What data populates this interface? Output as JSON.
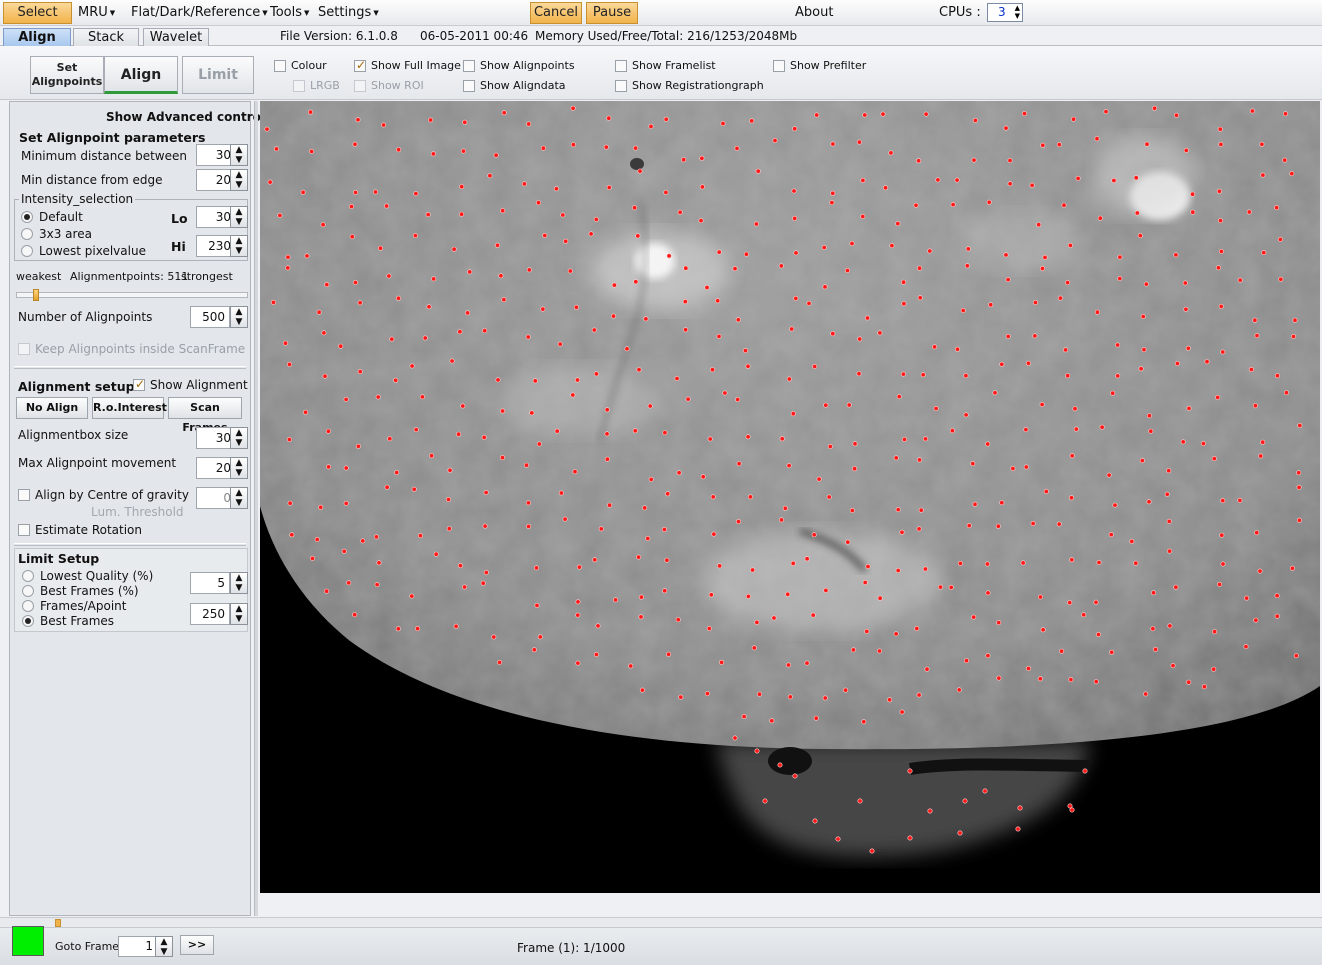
{
  "menu": {
    "select": "Select",
    "mru": "MRU",
    "flat": "Flat/Dark/Reference",
    "tools": "Tools",
    "settings": "Settings",
    "cancel": "Cancel",
    "pause": "Pause",
    "about": "About",
    "cpus_label": "CPUs :",
    "cpus_value": "3"
  },
  "tabs": [
    "Align",
    "Stack",
    "Wavelet"
  ],
  "info": {
    "file_version": "File Version: 6.1.0.8",
    "date": "06-05-2011 00:46",
    "memory": "Memory Used/Free/Total: 216/1253/2048Mb"
  },
  "toolbar": {
    "set_alignpoints_1": "Set",
    "set_alignpoints_2": "Alignpoints",
    "align": "Align",
    "limit": "Limit",
    "colour": "Colour",
    "lrgb": "LRGB",
    "show_full_image": "Show Full Image",
    "show_roi": "Show ROI",
    "show_alignpoints": "Show Alignpoints",
    "show_aligndata": "Show Aligndata",
    "show_framelist": "Show Framelist",
    "show_registrationgraph": "Show Registrationgraph",
    "show_prefilter": "Show Prefilter"
  },
  "panel": {
    "show_advanced": "Show Advanced controls",
    "set_ap_params": "Set Alignpoint parameters",
    "min_distance": "Minimum distance between",
    "min_distance_val": "30",
    "min_edge": "Min distance from edge",
    "min_edge_val": "20",
    "intensity_selection": "Intensity_selection",
    "default": "Default",
    "area3x3": "3x3 area",
    "lowest_pixel": "Lowest pixelvalue",
    "lo": "Lo",
    "lo_val": "30",
    "hi": "Hi",
    "hi_val": "230",
    "weakest": "weakest",
    "ap_count": "Alignmentpoints: 511",
    "strongest": "strongest",
    "slider_level": 0.07,
    "num_ap": "Number of Alignpoints",
    "num_ap_val": "500",
    "keep_inside": "Keep Alignpoints inside ScanFrame",
    "alignment_setup": "Alignment setup",
    "show_alignment": "Show Alignment",
    "no_align": "No Align",
    "roi": "R.o.Interest",
    "scan_frames": "Scan Frames",
    "box_size": "Alignmentbox size",
    "box_size_val": "30",
    "max_move": "Max Alignpoint movement",
    "max_move_val": "20",
    "centre_gravity": "Align by Centre of gravity",
    "centre_gravity_val": "0",
    "lum_threshold": "Lum. Threshold",
    "estimate_rotation": "Estimate Rotation",
    "limit_setup": "Limit Setup",
    "lowest_quality": "Lowest Quality (%)",
    "lowest_quality_val": "5",
    "best_frames_pct": "Best Frames (%)",
    "frames_apoint": "Frames/Apoint",
    "best_frames": "Best Frames",
    "best_frames_val": "250"
  },
  "bottom": {
    "goto_frame": "Goto Frame",
    "goto_val": "1",
    "next": ">>",
    "frame_status": "Frame (1): 1/1000",
    "status_color": "#00ee00"
  },
  "colors": {
    "alignpoint": "#ff1a1a",
    "accent_orange": "#f2b24a",
    "active_tab": "#a9c8ee"
  }
}
